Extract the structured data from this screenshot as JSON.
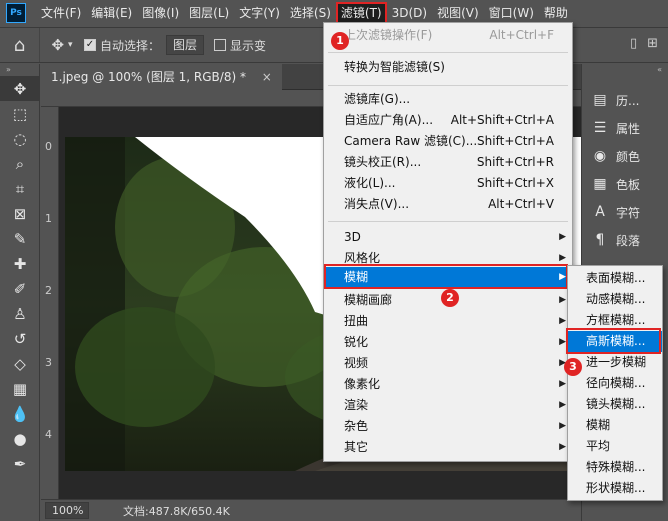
{
  "menubar": {
    "logo": "Ps",
    "items": [
      "文件(F)",
      "编辑(E)",
      "图像(I)",
      "图层(L)",
      "文字(Y)",
      "选择(S)",
      "滤镜(T)",
      "3D(D)",
      "视图(V)",
      "窗口(W)",
      "帮助"
    ]
  },
  "options": {
    "auto_select_label": "自动选择：",
    "auto_select_value": "图层",
    "show_transform_label": "显示变"
  },
  "document": {
    "tab_title": "1.jpeg @ 100% (图层 1, RGB/8) *",
    "close": "×",
    "zoom": "100%",
    "doc_size": "文档:487.8K/650.4K",
    "ruler_left_labels": [
      "0",
      "1",
      "2",
      "3",
      "4"
    ]
  },
  "right_panel": {
    "items": [
      {
        "icon": "history-icon",
        "label": "历..."
      },
      {
        "icon": "properties-icon",
        "label": "属性"
      },
      {
        "icon": "color-icon",
        "label": "颜色"
      },
      {
        "icon": "swatches-icon",
        "label": "色板"
      },
      {
        "icon": "character-icon",
        "label": "字符"
      },
      {
        "icon": "paragraph-icon",
        "label": "段落"
      }
    ]
  },
  "filter_menu": {
    "last_filter": {
      "label": "上次滤镜操作(F)",
      "shortcut": "Alt+Ctrl+F"
    },
    "convert_smart": "转换为智能滤镜(S)",
    "group2": [
      {
        "label": "滤镜库(G)...",
        "shortcut": ""
      },
      {
        "label": "自适应广角(A)...",
        "shortcut": "Alt+Shift+Ctrl+A"
      },
      {
        "label": "Camera Raw 滤镜(C)...",
        "shortcut": "Shift+Ctrl+A"
      },
      {
        "label": "镜头校正(R)...",
        "shortcut": "Shift+Ctrl+R"
      },
      {
        "label": "液化(L)...",
        "shortcut": "Shift+Ctrl+X"
      },
      {
        "label": "消失点(V)...",
        "shortcut": "Alt+Ctrl+V"
      }
    ],
    "group3": [
      "3D",
      "风格化",
      "模糊",
      "模糊画廊",
      "扭曲",
      "锐化",
      "视频",
      "像素化",
      "渲染",
      "杂色",
      "其它"
    ]
  },
  "blur_submenu": {
    "items": [
      "表面模糊...",
      "动感模糊...",
      "方框模糊...",
      "高斯模糊...",
      "进一步模糊",
      "径向模糊...",
      "镜头模糊...",
      "模糊",
      "平均",
      "特殊模糊...",
      "形状模糊..."
    ]
  },
  "badges": [
    "1",
    "2",
    "3"
  ]
}
